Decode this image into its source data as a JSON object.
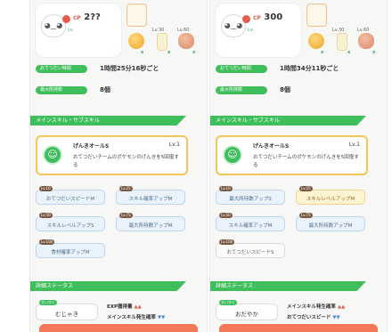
{
  "left": {
    "cp_label": "CP",
    "cp_value": "2??",
    "level": "Lv.",
    "ingredients": [
      {
        "lv": "",
        "count": "x"
      },
      {
        "lv": "Lv.30",
        "count": "x"
      },
      {
        "lv": "Lv.60",
        "count": "x"
      }
    ],
    "help_label": "おてつだい時間",
    "help_value": "1時間25分16秒ごと",
    "max_label": "最大所持数",
    "max_value": "8個",
    "section_skill": "メインスキル・サブスキル",
    "main_skill": {
      "name": "げんきオールS",
      "lv": "Lv.1",
      "desc": "おてつだいチームのポケモンのげんきを5回復する"
    },
    "subskills": [
      {
        "lv": "Lv.10",
        "name": "おてつだいスピードM"
      },
      {
        "lv": "Lv.25",
        "name": "スキル確率アップM"
      },
      {
        "lv": "Lv.50",
        "name": "スキルレベルアップS"
      },
      {
        "lv": "Lv.75",
        "name": "最大所持数アップM"
      },
      {
        "lv": "Lv.100",
        "name": "食材確率アップM"
      }
    ],
    "section_detail": "詳細ステータス",
    "nature_tag": "せいかく",
    "nature": "むじゃき",
    "effects": [
      {
        "name": "EXP獲得量",
        "marks": "▲▲"
      },
      {
        "name": "メインスキル発生確率",
        "marks": "▼▼"
      }
    ]
  },
  "right": {
    "cp_label": "CP",
    "cp_value": "300",
    "level": "Lv.",
    "ingredients": [
      {
        "lv": "",
        "count": "x"
      },
      {
        "lv": "Lv.30",
        "count": "x"
      },
      {
        "lv": "Lv.60",
        "count": "x"
      }
    ],
    "help_label": "おてつだい時間",
    "help_value": "1時間34分11秒ごと",
    "max_label": "最大所持数",
    "max_value": "8個",
    "section_skill": "メインスキル・サブスキル",
    "main_skill": {
      "name": "げんきオールS",
      "lv": "Lv.1",
      "desc": "おてつだいチームのポケモンのげんきを5回復する"
    },
    "subskills": [
      {
        "lv": "Lv.10",
        "name": "最大所持数アップS"
      },
      {
        "lv": "Lv.25",
        "name": "スキルレベルアップM"
      },
      {
        "lv": "Lv.50",
        "name": "スキル確率アップM"
      },
      {
        "lv": "Lv.75",
        "name": "最大所持数アップM"
      },
      {
        "lv": "Lv.100",
        "name": "おてつだいスピードS"
      }
    ],
    "section_detail": "詳細ステータス",
    "nature_tag": "せいかく",
    "nature": "おだやか",
    "effects": [
      {
        "name": "メインスキル発生確率",
        "marks": "▲▲"
      },
      {
        "name": "おてつだいスピード",
        "marks": "▼▼"
      }
    ]
  }
}
